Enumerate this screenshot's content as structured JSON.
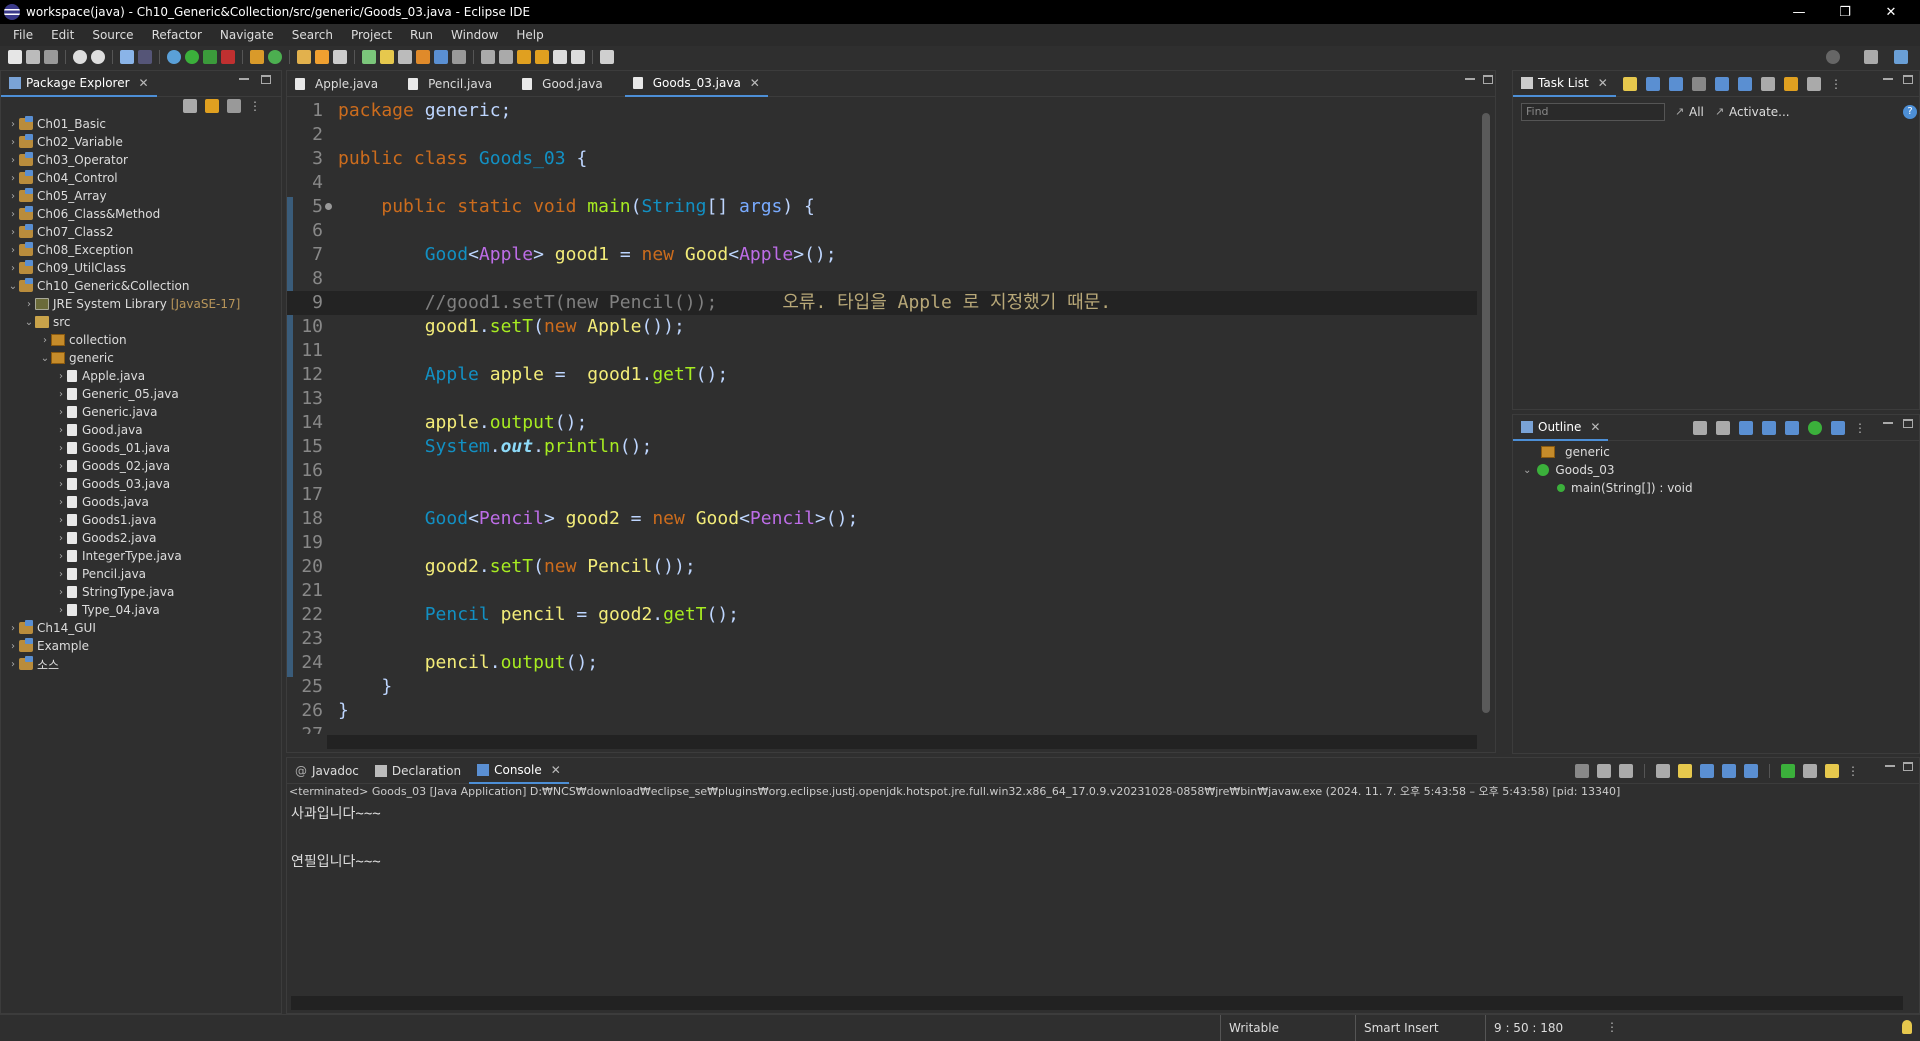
{
  "window": {
    "title": "workspace(java) - Ch10_Generic&Collection/src/generic/Goods_03.java - Eclipse IDE"
  },
  "menu": [
    "File",
    "Edit",
    "Source",
    "Refactor",
    "Navigate",
    "Search",
    "Project",
    "Run",
    "Window",
    "Help"
  ],
  "package_explorer": {
    "tab_label": "Package Explorer",
    "projects": [
      "Ch01_Basic",
      "Ch02_Variable",
      "Ch03_Operator",
      "Ch04_Control",
      "Ch05_Array",
      "Ch06_Class&Method",
      "Ch07_Class2",
      "Ch08_Exception",
      "Ch09_UtilClass"
    ],
    "open_project": "Ch10_Generic&Collection",
    "jre": "JRE System Library",
    "jre_version": "[JavaSE-17]",
    "src": "src",
    "pkg_collection": "collection",
    "pkg_generic": "generic",
    "files": [
      "Apple.java",
      "Generic_05.java",
      "Generic.java",
      "Good.java",
      "Goods_01.java",
      "Goods_02.java",
      "Goods_03.java",
      "Goods.java",
      "Goods1.java",
      "Goods2.java",
      "IntegerType.java",
      "Pencil.java",
      "StringType.java",
      "Type_04.java"
    ],
    "after_projects": [
      "Ch14_GUI",
      "Example",
      "소스"
    ]
  },
  "editor": {
    "tabs": [
      "Apple.java",
      "Pencil.java",
      "Good.java",
      "Goods_03.java"
    ],
    "active_tab": "Goods_03.java",
    "lines": [
      {
        "n": "1",
        "t": "package generic;"
      },
      {
        "n": "2",
        "t": ""
      },
      {
        "n": "3",
        "t": "public class Goods_03 {"
      },
      {
        "n": "4",
        "t": ""
      },
      {
        "n": "5",
        "t": "    public static void main(String[] args) {"
      },
      {
        "n": "6",
        "t": ""
      },
      {
        "n": "7",
        "t": "        Good<Apple> good1 = new Good<Apple>();"
      },
      {
        "n": "8",
        "t": ""
      },
      {
        "n": "9",
        "t": "        //good1.setT(new Pencil());      오류. 타입을 Apple 로 지정했기 때문."
      },
      {
        "n": "10",
        "t": "        good1.setT(new Apple());"
      },
      {
        "n": "11",
        "t": ""
      },
      {
        "n": "12",
        "t": "        Apple apple =  good1.getT();"
      },
      {
        "n": "13",
        "t": ""
      },
      {
        "n": "14",
        "t": "        apple.output();"
      },
      {
        "n": "15",
        "t": "        System.out.println();"
      },
      {
        "n": "16",
        "t": ""
      },
      {
        "n": "17",
        "t": ""
      },
      {
        "n": "18",
        "t": "        Good<Pencil> good2 = new Good<Pencil>();"
      },
      {
        "n": "19",
        "t": ""
      },
      {
        "n": "20",
        "t": "        good2.setT(new Pencil());"
      },
      {
        "n": "21",
        "t": ""
      },
      {
        "n": "22",
        "t": "        Pencil pencil = good2.getT();"
      },
      {
        "n": "23",
        "t": ""
      },
      {
        "n": "24",
        "t": "        pencil.output();"
      },
      {
        "n": "25",
        "t": "    }"
      },
      {
        "n": "26",
        "t": "}"
      },
      {
        "n": "27",
        "t": ""
      }
    ]
  },
  "task_list": {
    "tab_label": "Task List",
    "find_placeholder": "Find",
    "all_label": "All",
    "activate_label": "Activate..."
  },
  "outline": {
    "tab_label": "Outline",
    "package": "generic",
    "class": "Goods_03",
    "method": "main(String[]) : void"
  },
  "console": {
    "tabs": [
      "Javadoc",
      "Declaration",
      "Console"
    ],
    "active_tab": "Console",
    "header": "<terminated> Goods_03 [Java Application] D:₩NCS₩download₩eclipse_se₩plugins₩org.eclipse.justj.openjdk.hotspot.jre.full.win32.x86_64_17.0.9.v20231028-0858₩jre₩bin₩javaw.exe  (2024. 11. 7. 오후 5:43:58 – 오후 5:43:58) [pid: 13340]",
    "output1": "사과입니다~~~",
    "output2": "연필입니다~~~"
  },
  "status": {
    "writable": "Writable",
    "insert_mode": "Smart Insert",
    "position": "9 : 50 : 180"
  },
  "colors": {
    "keyword": "#cc6c1d",
    "type": "#1290c3",
    "variable": "#f3ec79",
    "method": "#a7ec21",
    "type_param": "#bd6de7",
    "comment": "#808080",
    "background": "#2f2f2f"
  }
}
